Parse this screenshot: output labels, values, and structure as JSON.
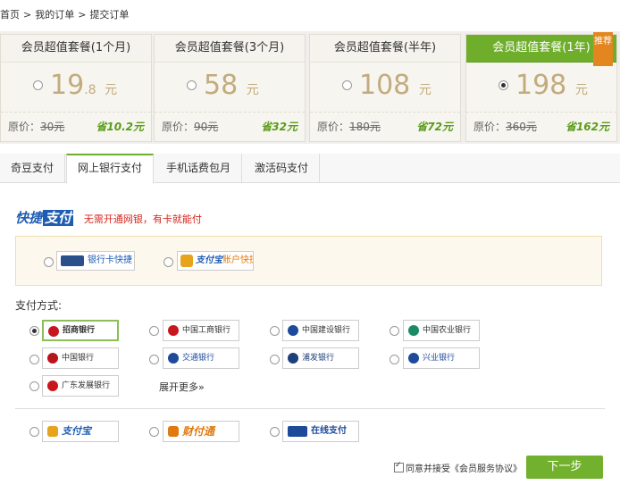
{
  "breadcrumb": {
    "home": "首页",
    "sep1": ">",
    "orders": "我的订单",
    "sep2": ">",
    "current": "提交订单"
  },
  "plans": [
    {
      "name": "会员超值套餐(1个月)",
      "price": "19",
      "price_dec": ".8",
      "unit": "元",
      "orig_label": "原价：",
      "orig": "30元",
      "save": "省10.2元",
      "selected": false
    },
    {
      "name": "会员超值套餐(3个月)",
      "price": "58",
      "price_dec": "",
      "unit": "元",
      "orig_label": "原价：",
      "orig": "90元",
      "save": "省32元",
      "selected": false
    },
    {
      "name": "会员超值套餐(半年)",
      "price": "108",
      "price_dec": "",
      "unit": "元",
      "orig_label": "原价：",
      "orig": "180元",
      "save": "省72元",
      "selected": false
    },
    {
      "name": "会员超值套餐(1年)",
      "price": "198",
      "price_dec": "",
      "unit": "元",
      "orig_label": "原价：",
      "orig": "360元",
      "save": "省162元",
      "selected": true,
      "ribbon": "推荐"
    }
  ],
  "tabs": [
    "奇豆支付",
    "网上银行支付",
    "手机话费包月",
    "激活码支付"
  ],
  "active_tab": 1,
  "quick": {
    "logo_a": "快捷",
    "logo_b": "支付",
    "tip": "无需开通网银，有卡就能付",
    "card_label": "银行卡快捷",
    "alipay_brand": "支付宝",
    "alipay_label": "账户快捷"
  },
  "pay_title": "支付方式:",
  "banks": [
    {
      "name": "招商银行",
      "color": "#c8161d",
      "selected": true
    },
    {
      "name": "中国工商银行",
      "color": "#c8161d",
      "selected": false
    },
    {
      "name": "中国建设银行",
      "color": "#1d4b9a",
      "selected": false
    },
    {
      "name": "中国农业银行",
      "color": "#1b8a67",
      "selected": false
    },
    {
      "name": "中国银行",
      "color": "#b8141b",
      "selected": false
    },
    {
      "name": "交通银行",
      "color": "#1d4b9a",
      "selected": false
    },
    {
      "name": "浦发银行",
      "color": "#1d3f7a",
      "selected": false
    },
    {
      "name": "兴业银行",
      "color": "#1d4b9a",
      "selected": false
    },
    {
      "name": "广东发展银行",
      "color": "#c8161d",
      "selected": false
    }
  ],
  "more": "展开更多",
  "others": [
    {
      "name": "支付宝",
      "color": "#e6a31b"
    },
    {
      "name": "财付通",
      "color": "#e07a10"
    },
    {
      "name": "在线支付",
      "color": "#1d4b9a"
    }
  ],
  "agree_text": "同意并接受《会员服务协议》",
  "next_button": "下一步"
}
